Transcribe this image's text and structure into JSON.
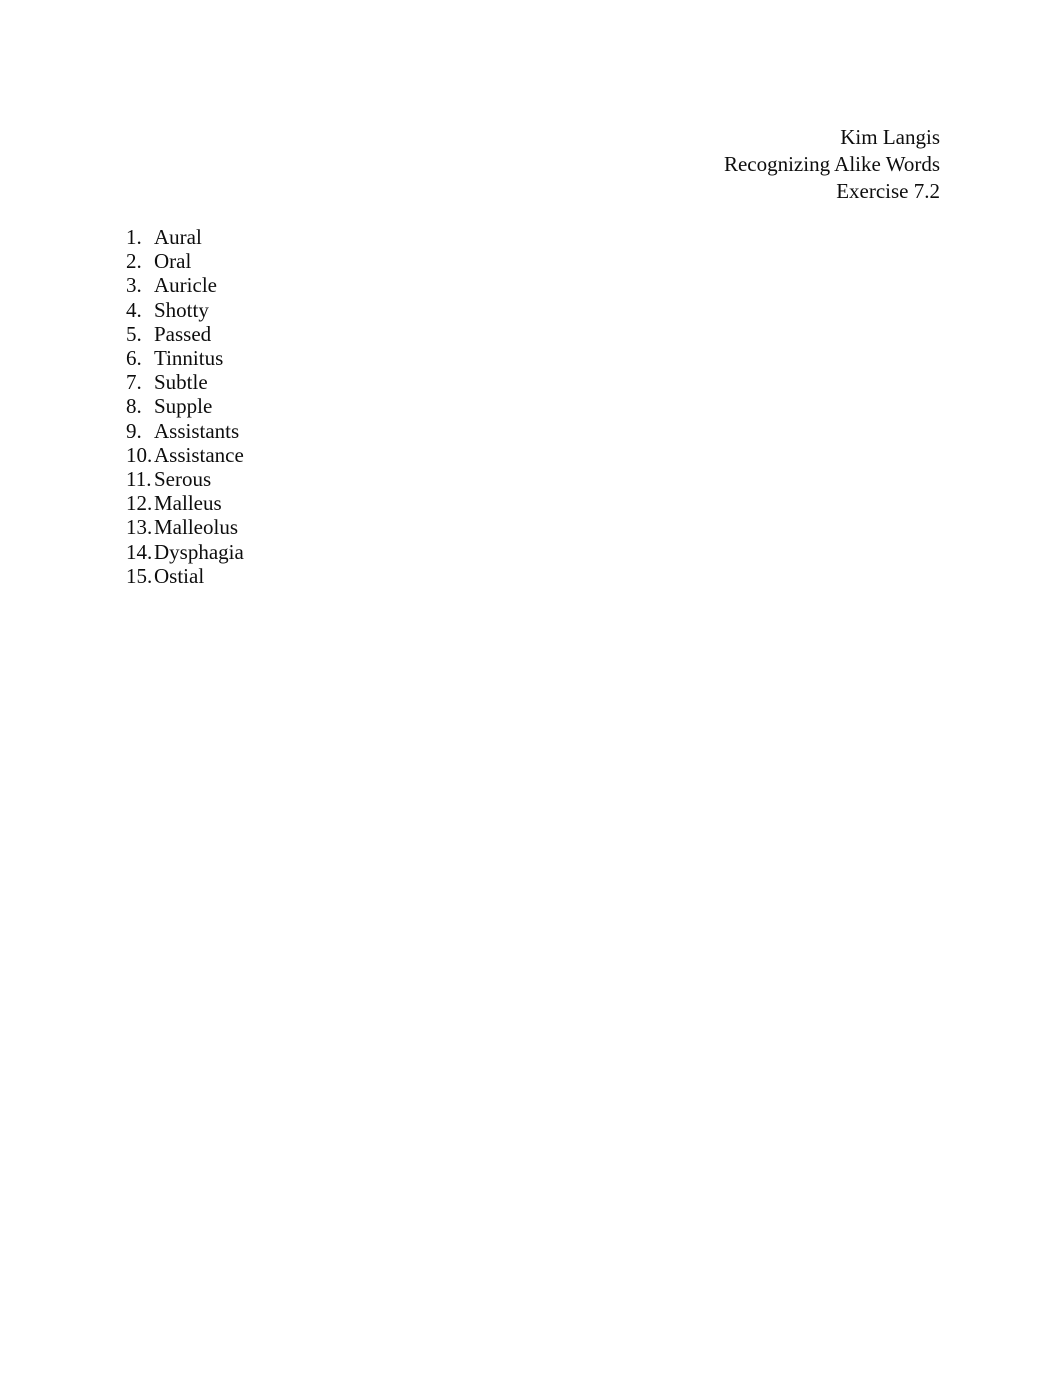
{
  "document": {
    "header": {
      "lines": [
        "Kim Langis",
        "Recognizing Alike Words",
        "Exercise 7.2"
      ],
      "author": "Kim Langis",
      "assignment_title": "Recognizing Alike Words",
      "exercise": "Exercise 7.2"
    },
    "list": {
      "items": [
        {
          "number": "1.",
          "term": "Aural"
        },
        {
          "number": "2.",
          "term": "Oral"
        },
        {
          "number": "3.",
          "term": "Auricle"
        },
        {
          "number": "4.",
          "term": "Shotty"
        },
        {
          "number": "5.",
          "term": "Passed"
        },
        {
          "number": "6.",
          "term": "Tinnitus"
        },
        {
          "number": "7.",
          "term": "Subtle"
        },
        {
          "number": "8.",
          "term": "Supple"
        },
        {
          "number": "9.",
          "term": "Assistants"
        },
        {
          "number": "10.",
          "term": "Assistance"
        },
        {
          "number": "11.",
          "term": "Serous"
        },
        {
          "number": "12.",
          "term": "Malleus"
        },
        {
          "number": "13.",
          "term": "Malleolus"
        },
        {
          "number": "14.",
          "term": "Dysphagia"
        },
        {
          "number": "15.",
          "term": "Ostial"
        }
      ]
    },
    "colors": {
      "page_background": "#ffffff",
      "text": "#0d0d0d"
    }
  }
}
